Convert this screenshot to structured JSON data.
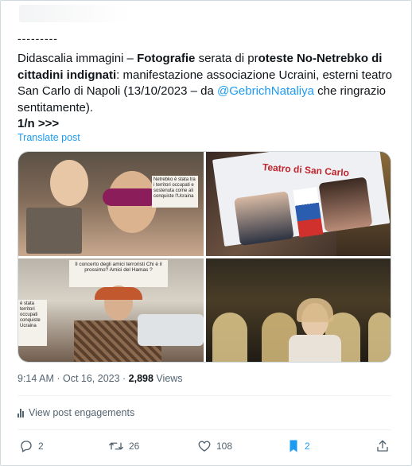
{
  "post": {
    "separator": "---------",
    "caption_lead": "Didascalia immagini – ",
    "caption_bold1": "Fotografie",
    "caption_mid1": " serata di pr",
    "caption_bold2": "oteste No-Netrebko di cittadini indignati",
    "caption_mid2": ": manifestazione associazione Ucraini, esterni teatro San Carlo di Napoli (13/10/2023 – da ",
    "mention": "@GebrichNataliya",
    "caption_tail": " che ringrazio sentitamente).",
    "thread_count": "1/n >>>",
    "translate_label": "Translate post"
  },
  "media": {
    "photo_texts": {
      "sign_top_left": "Netrebko è stata tra i territori occupati e sostenuta come ali conquiste l'Ucraina",
      "sign_teatro": "Teatro di San Carlo",
      "sign_bottom_center": "Il concerto degli amici terroristi Chi è il prossimo? Amici del Hamas ?",
      "sign_bottom_left": "è stata territori occupati conquiste Ucraina"
    }
  },
  "meta": {
    "time": "9:14 AM",
    "separator": " · ",
    "date": "Oct 16, 2023",
    "views_count": "2,898",
    "views_label": " Views"
  },
  "engagements": {
    "label": "View post engagements"
  },
  "actions": {
    "replies": "2",
    "reposts": "26",
    "likes": "108",
    "bookmarks": "2"
  },
  "colors": {
    "accent": "#1d9bf0",
    "text": "#0f1419",
    "muted": "#536471"
  }
}
